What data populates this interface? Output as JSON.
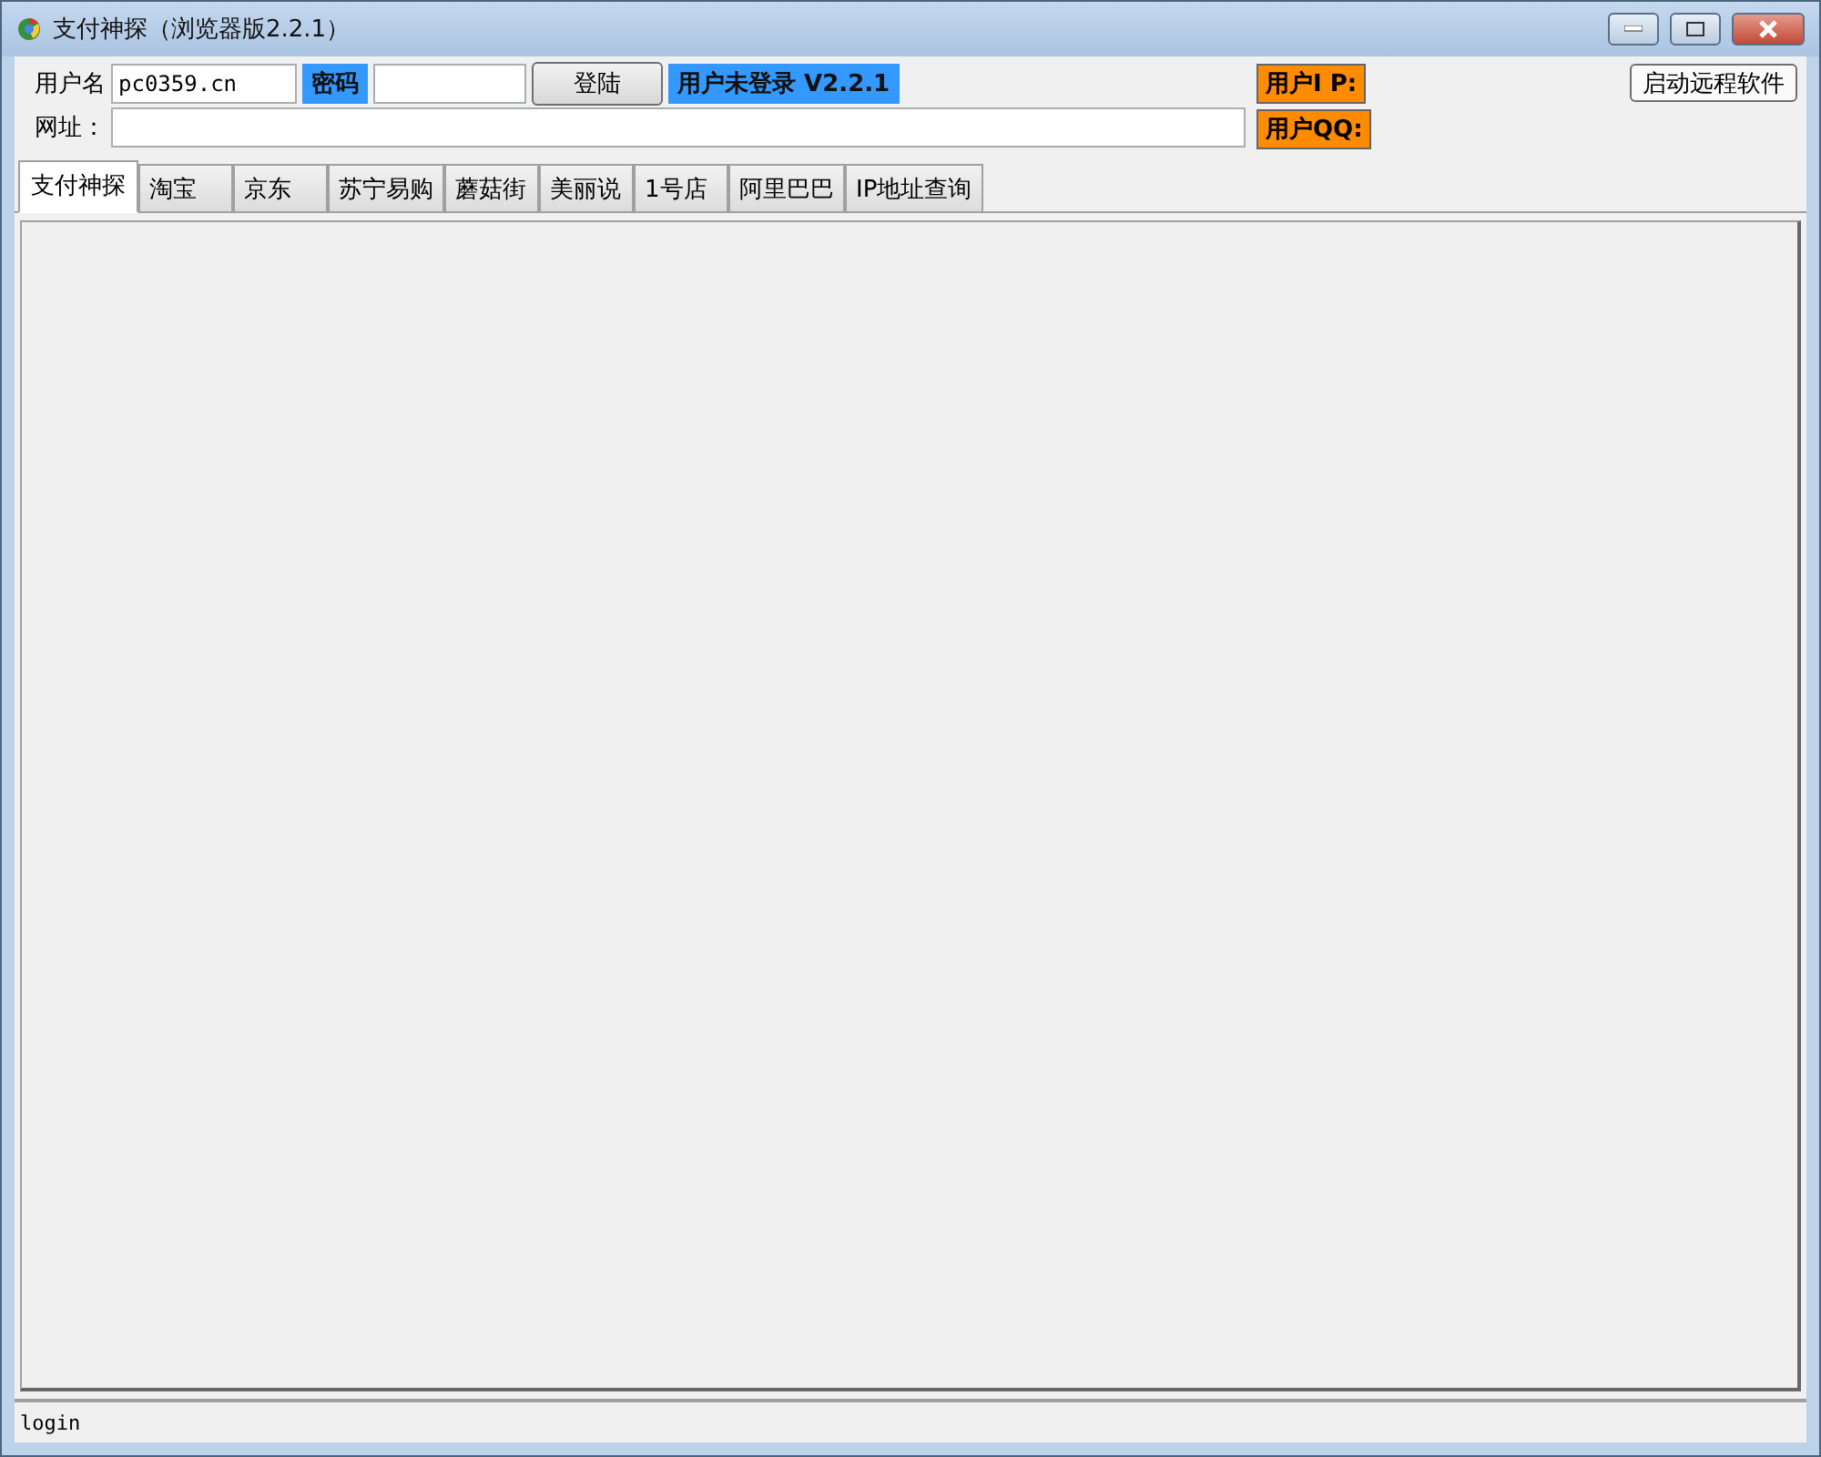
{
  "window": {
    "title": "支付神探（浏览器版2.2.1）"
  },
  "login": {
    "username_label": "用户名",
    "username": "pc0359.cn",
    "password_label": "密码",
    "login_button": "登陆",
    "status": "用户未登录 V2.2.1"
  },
  "url": {
    "label": "网址："
  },
  "user_info": {
    "ip_label": "用户I P:",
    "qq_label": "用户QQ:"
  },
  "remote_button": "启动远程软件",
  "tabs": [
    {
      "label": "支付神探",
      "selected": true
    },
    {
      "label": "淘宝",
      "selected": false
    },
    {
      "label": "京东",
      "selected": false
    },
    {
      "label": "苏宁易购",
      "selected": false
    },
    {
      "label": "蘑菇街",
      "selected": false
    },
    {
      "label": "美丽说",
      "selected": false
    },
    {
      "label": "1号店",
      "selected": false
    },
    {
      "label": "阿里巴巴",
      "selected": false
    },
    {
      "label": "IP地址查询",
      "selected": false
    }
  ],
  "status_bar": "login"
}
